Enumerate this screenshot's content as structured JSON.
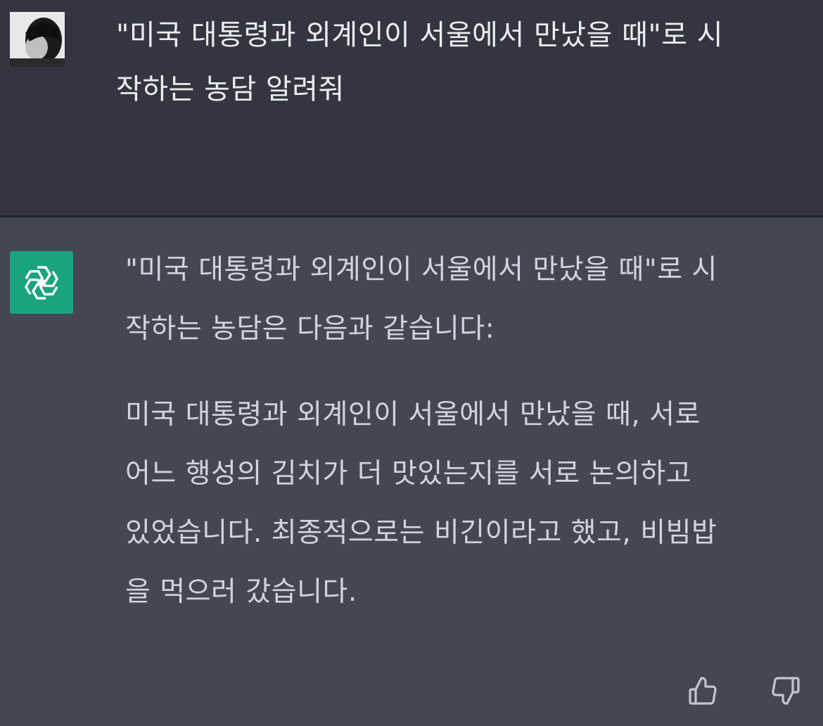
{
  "user_message": {
    "avatar": "user-avatar-photo",
    "lines": [
      "\"미국 대통령과 외계인이 서울에서 만났을 때\"로 시",
      "작하는 농담 알려줘"
    ]
  },
  "assistant_message": {
    "avatar": "openai-logo-icon",
    "accent_color": "#19a37f",
    "lines": [
      "\"미국 대통령과 외계인이 서울에서 만났을 때\"로 시",
      "작하는 농담은 다음과 같습니다:",
      "미국 대통령과 외계인이 서울에서 만났을 때, 서로",
      "어느 행성의 김치가 더 맛있는지를 서로 논의하고",
      "있었습니다. 최종적으로는 비긴이라고 했고, 비빔밥",
      "을 먹으러 갔습니다."
    ]
  },
  "feedback": {
    "like_icon": "thumbs-up-icon",
    "dislike_icon": "thumbs-down-icon"
  },
  "colors": {
    "user_bg": "#343541",
    "assistant_bg": "#444654",
    "text": "#d1d5db"
  }
}
